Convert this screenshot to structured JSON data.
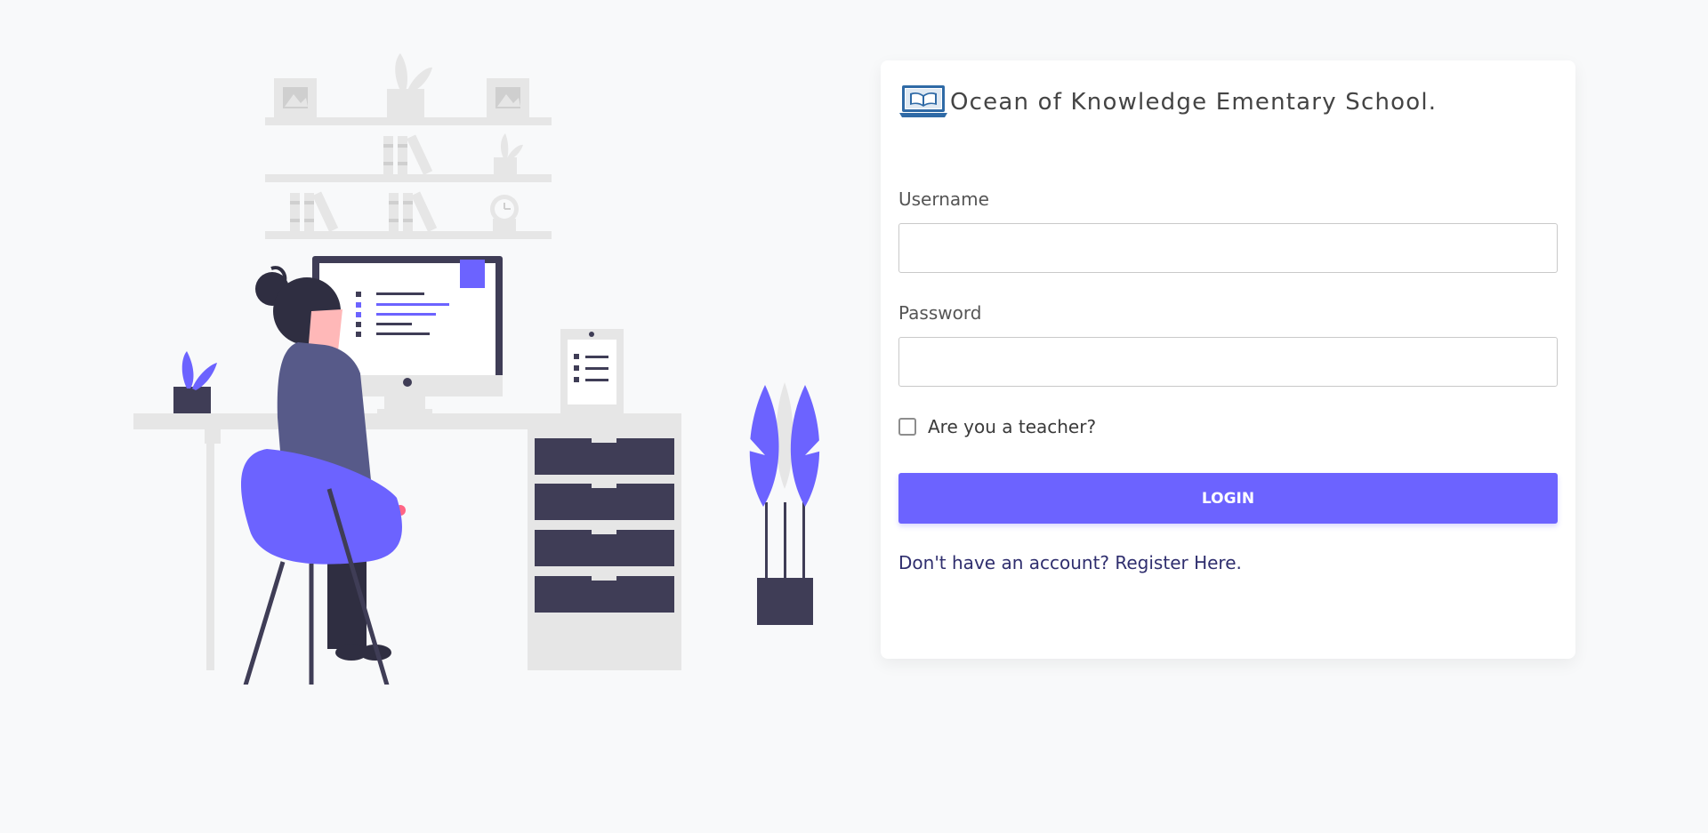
{
  "brand": {
    "title": "Ocean of Knowledge Ementary School.",
    "logo_icon": "laptop-book-icon"
  },
  "form": {
    "username_label": "Username",
    "username_value": "",
    "password_label": "Password",
    "password_value": "",
    "teacher_label": "Are you a teacher?",
    "teacher_checked": false,
    "login_label": "LOGIN",
    "register_label": "Don't have an account? Register Here."
  },
  "colors": {
    "accent": "#6c63ff",
    "dark": "#3f3d56",
    "link": "#2f2e6e",
    "background": "#f8f9fa"
  }
}
